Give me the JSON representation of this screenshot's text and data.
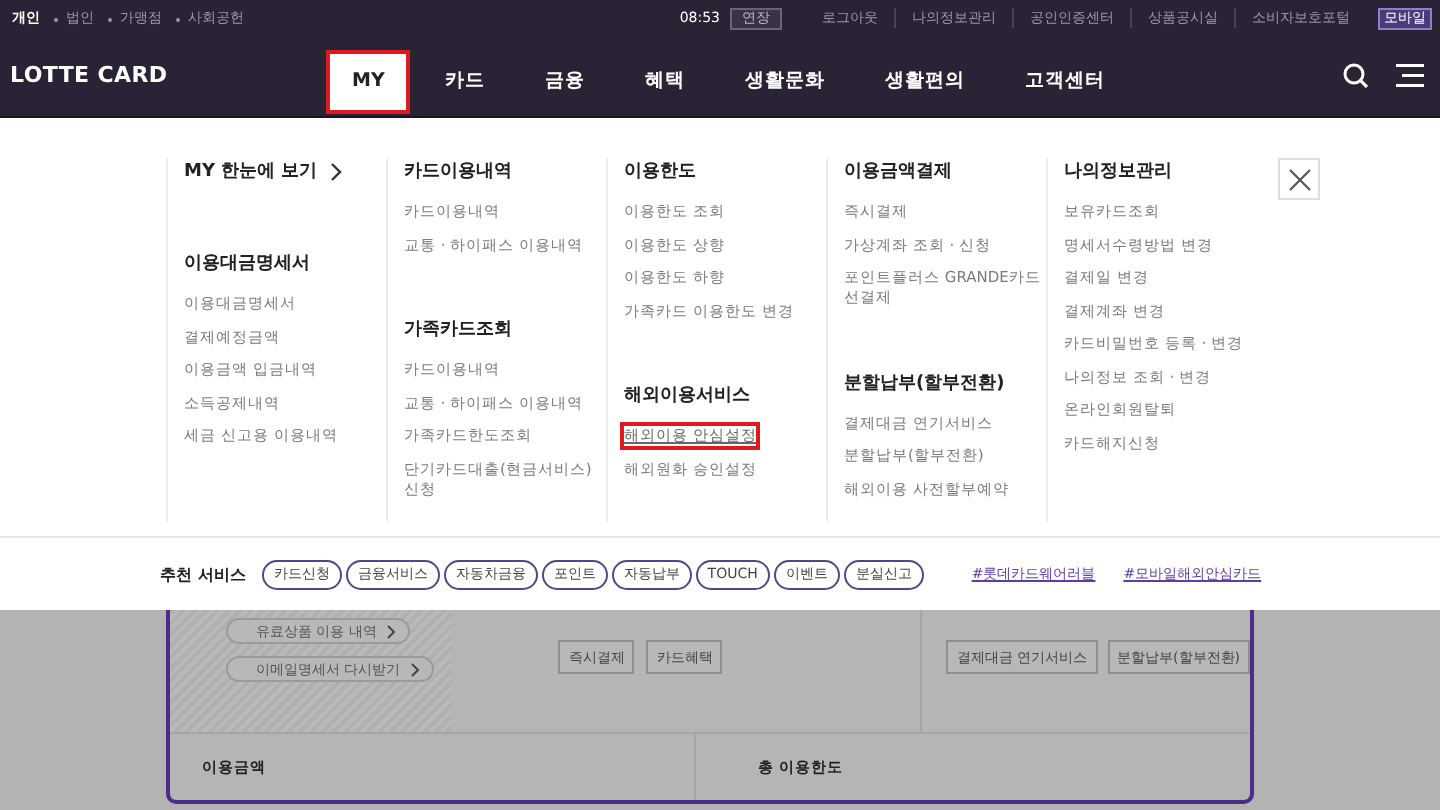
{
  "top_bar": {
    "segments": [
      {
        "label": "개인",
        "selected": true
      },
      {
        "label": "법인",
        "selected": false
      },
      {
        "label": "가맹점",
        "selected": false
      },
      {
        "label": "사회공헌",
        "selected": false
      }
    ],
    "session_time": "08:53",
    "extend_button": "연장",
    "links": [
      "로그아웃",
      "나의정보관리",
      "공인인증센터",
      "상품공시실",
      "소비자보호포털"
    ],
    "mobile_button": "모바일"
  },
  "nav": {
    "logo": "LOTTE CARD",
    "items": [
      {
        "label": "MY",
        "selected": true
      },
      {
        "label": "카드",
        "selected": false
      },
      {
        "label": "금융",
        "selected": false
      },
      {
        "label": "혜택",
        "selected": false
      },
      {
        "label": "생활문화",
        "selected": false
      },
      {
        "label": "생활편의",
        "selected": false
      },
      {
        "label": "고객센터",
        "selected": false
      }
    ]
  },
  "mega_menu": {
    "columns": [
      [
        {
          "title": "MY 한눈에 보기",
          "kind": "link"
        },
        {
          "title": "이용대금명세서",
          "kind": "group",
          "items": [
            {
              "label": "이용대금명세서",
              "highlighted": false
            },
            {
              "label": "결제예정금액",
              "highlighted": false
            },
            {
              "label": "이용금액 입금내역",
              "highlighted": false
            },
            {
              "label": "소득공제내역",
              "highlighted": false
            },
            {
              "label": "세금 신고용 이용내역",
              "highlighted": false
            }
          ]
        }
      ],
      [
        {
          "title": "카드이용내역",
          "kind": "group",
          "items": [
            {
              "label": "카드이용내역",
              "highlighted": false
            },
            {
              "label": "교통 · 하이패스 이용내역",
              "highlighted": false
            }
          ]
        },
        {
          "title": "가족카드조회",
          "kind": "group",
          "items": [
            {
              "label": "카드이용내역",
              "highlighted": false
            },
            {
              "label": "교통 · 하이패스 이용내역",
              "highlighted": false
            },
            {
              "label": "가족카드한도조회",
              "highlighted": false
            },
            {
              "label": "단기카드대출(현금서비스) 신청",
              "highlighted": false
            }
          ]
        }
      ],
      [
        {
          "title": "이용한도",
          "kind": "group",
          "items": [
            {
              "label": "이용한도 조회",
              "highlighted": false
            },
            {
              "label": "이용한도 상향",
              "highlighted": false
            },
            {
              "label": "이용한도 하향",
              "highlighted": false
            },
            {
              "label": "가족카드 이용한도 변경",
              "highlighted": false
            }
          ]
        },
        {
          "title": "해외이용서비스",
          "kind": "group",
          "items": [
            {
              "label": "해외이용 안심설정",
              "highlighted": true
            },
            {
              "label": "해외원화 승인설정",
              "highlighted": false
            }
          ]
        }
      ],
      [
        {
          "title": "이용금액결제",
          "kind": "group",
          "items": [
            {
              "label": "즉시결제",
              "highlighted": false
            },
            {
              "label": "가상계좌 조회 · 신청",
              "highlighted": false
            },
            {
              "label": "포인트플러스 GRANDE카드 선결제",
              "highlighted": false
            }
          ]
        },
        {
          "title": "분할납부(할부전환)",
          "kind": "group",
          "items": [
            {
              "label": "결제대금 연기서비스",
              "highlighted": false
            },
            {
              "label": "분할납부(할부전환)",
              "highlighted": false
            },
            {
              "label": "해외이용 사전할부예약",
              "highlighted": false
            }
          ]
        }
      ],
      [
        {
          "title": "나의정보관리",
          "kind": "group",
          "items": [
            {
              "label": "보유카드조회",
              "highlighted": false
            },
            {
              "label": "명세서수령방법 변경",
              "highlighted": false
            },
            {
              "label": "결제일 변경",
              "highlighted": false
            },
            {
              "label": "결제계좌 변경",
              "highlighted": false
            },
            {
              "label": "카드비밀번호 등록 · 변경",
              "highlighted": false
            },
            {
              "label": "나의정보 조회 · 변경",
              "highlighted": false
            },
            {
              "label": "온라인회원탈퇴",
              "highlighted": false
            },
            {
              "label": "카드해지신청",
              "highlighted": false
            }
          ]
        }
      ]
    ]
  },
  "recommended": {
    "title": "추천 서비스",
    "chips": [
      "카드신청",
      "금융서비스",
      "자동차금융",
      "포인트",
      "자동납부",
      "TOUCH",
      "이벤트",
      "분실신고"
    ],
    "tags": [
      "#롯데카드웨어러블",
      "#모바일해외안심카드"
    ]
  },
  "background_page": {
    "side_links": [
      "유료상품 이용 내역",
      "이메일명세서 다시받기"
    ],
    "actions_left": [
      "즉시결제",
      "카드혜택"
    ],
    "actions_right": [
      "결제대금 연기서비스",
      "분할납부(할부전환)"
    ],
    "summary": [
      "이용금액",
      "총 이용한도"
    ]
  }
}
